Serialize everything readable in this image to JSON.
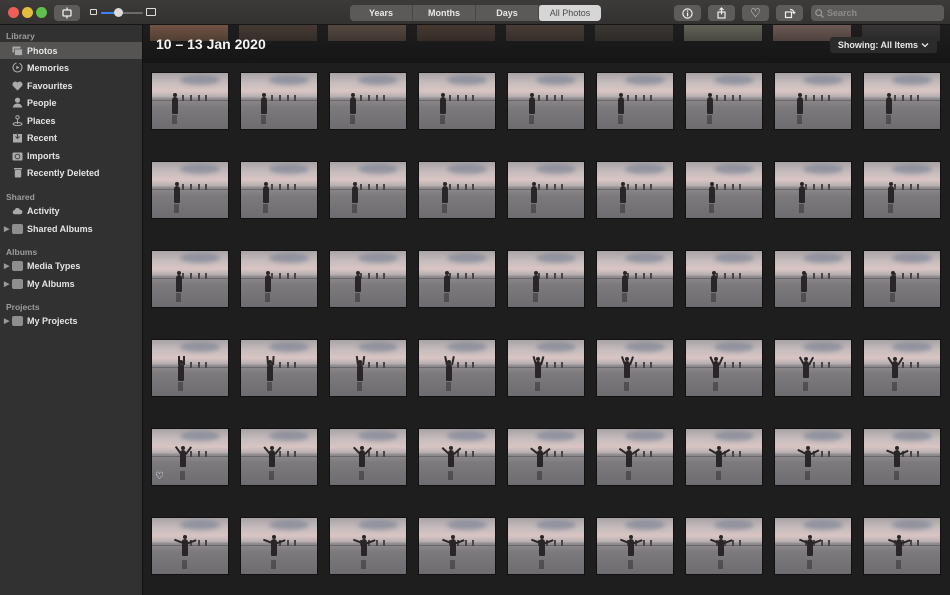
{
  "window": {
    "traffic_lights": [
      "close",
      "minimize",
      "maximize"
    ],
    "colors": {
      "close": "#ec5f57",
      "minimize": "#e2bd41",
      "maximize": "#5fc14c",
      "accent": "#3b82f6"
    }
  },
  "toolbar": {
    "sidebar_toggle_icon": "sidebar-toggle-icon",
    "zoom_slider": {
      "value_fraction": 0.4
    },
    "view_tabs": [
      "Years",
      "Months",
      "Days",
      "All Photos"
    ],
    "active_tab": "All Photos",
    "info_icon": "ⓘ",
    "share_icon": "share-icon",
    "favourite_icon": "♡",
    "rotate_icon": "rotate-icon",
    "search_placeholder": "Search",
    "search_value": ""
  },
  "sidebar": {
    "sections": [
      {
        "label": "Library",
        "items": [
          {
            "label": "Photos",
            "icon": "photos-icon",
            "selected": true
          },
          {
            "label": "Memories",
            "icon": "memories-icon"
          },
          {
            "label": "Favourites",
            "icon": "heart-icon"
          },
          {
            "label": "People",
            "icon": "person-icon"
          },
          {
            "label": "Places",
            "icon": "pin-icon"
          },
          {
            "label": "Recent",
            "icon": "recent-icon"
          },
          {
            "label": "Imports",
            "icon": "camera-icon"
          },
          {
            "label": "Recently Deleted",
            "icon": "trash-icon"
          }
        ]
      },
      {
        "label": "Shared",
        "items": [
          {
            "label": "Activity",
            "icon": "cloud-icon"
          },
          {
            "label": "Shared Albums",
            "icon": "folder-icon",
            "expandable": true
          }
        ]
      },
      {
        "label": "Albums",
        "items": [
          {
            "label": "Media Types",
            "icon": "folder-icon",
            "expandable": true
          },
          {
            "label": "My Albums",
            "icon": "folder-icon",
            "expandable": true
          }
        ]
      },
      {
        "label": "Projects",
        "items": [
          {
            "label": "My Projects",
            "icon": "folder-icon",
            "expandable": true
          }
        ]
      }
    ]
  },
  "main": {
    "date_range": "10 – 13 Jan 2020",
    "showing_label": "Showing: All Items",
    "grid": {
      "rows": 6,
      "columns": 9,
      "favourited_photo_index": 36
    }
  }
}
